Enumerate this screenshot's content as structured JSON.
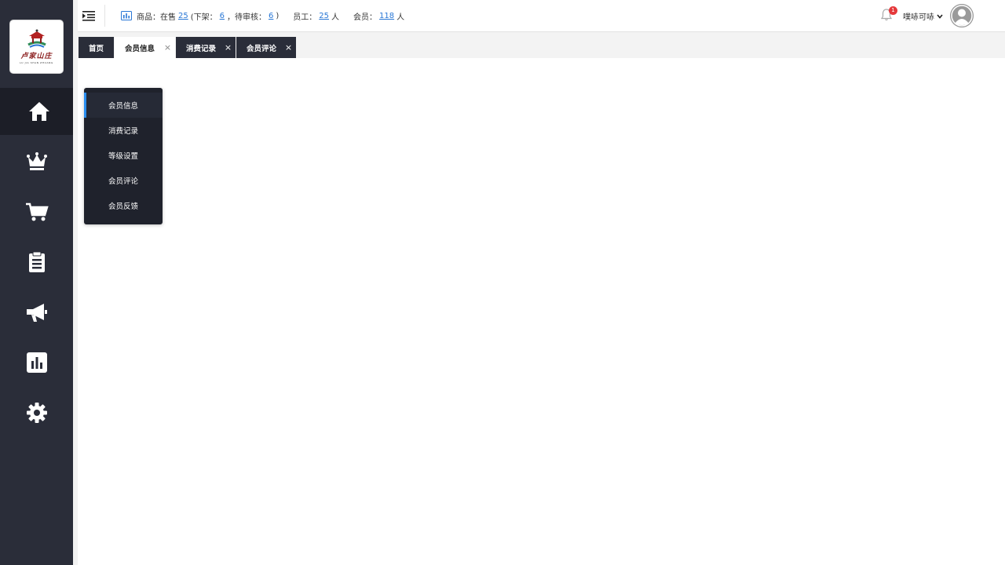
{
  "sidebar": {
    "logo": {
      "cn": "卢家山庄",
      "en": "LU JIA SHAN ZHUANG"
    },
    "items": [
      {
        "name": "home",
        "icon": "home-icon",
        "active": true
      },
      {
        "name": "member",
        "icon": "crown-icon",
        "active": false
      },
      {
        "name": "goods",
        "icon": "cart-icon",
        "active": false
      },
      {
        "name": "orders",
        "icon": "clipboard-icon",
        "active": false
      },
      {
        "name": "marketing",
        "icon": "megaphone-icon",
        "active": false
      },
      {
        "name": "statistics",
        "icon": "bar-chart-icon",
        "active": false
      },
      {
        "name": "settings",
        "icon": "gear-icon",
        "active": false
      }
    ]
  },
  "topbar": {
    "stats": {
      "goods_label": "商品：在售",
      "on_sale": "25",
      "off_shelf_label": "(下架：",
      "off_shelf": "6",
      "pending_label": "，待审核：",
      "pending": "6",
      "close_paren": ")",
      "staff_label": "员工：",
      "staff": "25",
      "staff_unit": "人",
      "member_label": "会员：",
      "members": "118",
      "member_unit": "人"
    },
    "notifications": "1",
    "username": "噗哧可哧"
  },
  "tabs": [
    {
      "label": "首页",
      "style": "dark",
      "closable": false
    },
    {
      "label": "会员信息",
      "style": "light",
      "closable": true
    },
    {
      "label": "消费记录",
      "style": "dark",
      "closable": true
    },
    {
      "label": "会员评论",
      "style": "dark",
      "closable": true
    }
  ],
  "close_glyph": "×",
  "submenu": {
    "items": [
      {
        "label": "会员信息",
        "active": true
      },
      {
        "label": "消费记录",
        "active": false
      },
      {
        "label": "等级设置",
        "active": false
      },
      {
        "label": "会员评论",
        "active": false
      },
      {
        "label": "会员反馈",
        "active": false
      }
    ]
  },
  "colors": {
    "sidebar_bg": "#2a2d39",
    "accent": "#2a8ef0",
    "link": "#2a78d6",
    "badge": "#e5393b"
  }
}
